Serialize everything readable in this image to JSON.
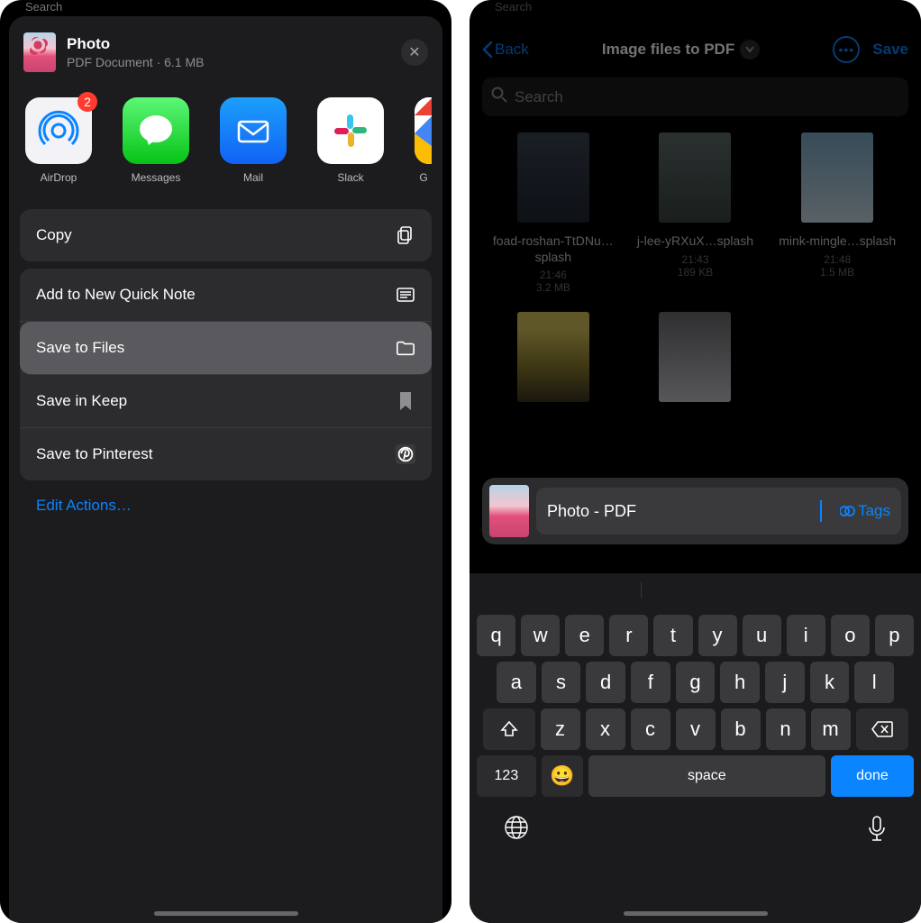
{
  "left": {
    "back_hint": "Search",
    "header": {
      "title": "Photo",
      "subtitle": "PDF Document · 6.1 MB"
    },
    "apps": [
      {
        "label": "AirDrop",
        "badge": "2"
      },
      {
        "label": "Messages"
      },
      {
        "label": "Mail"
      },
      {
        "label": "Slack"
      },
      {
        "label": "G"
      }
    ],
    "actions_a": [
      {
        "label": "Copy"
      }
    ],
    "actions_b": [
      {
        "label": "Add to New Quick Note"
      },
      {
        "label": "Save to Files",
        "highlight": true
      },
      {
        "label": "Save in Keep"
      },
      {
        "label": "Save to Pinterest"
      }
    ],
    "edit": "Edit Actions…"
  },
  "right": {
    "back_hint": "Search",
    "nav": {
      "back": "Back",
      "title": "Image files to PDF",
      "save": "Save"
    },
    "search_placeholder": "Search",
    "files": [
      {
        "name": "foad-roshan-TtDNu…splash",
        "date": "21:46",
        "size": "3.2 MB"
      },
      {
        "name": "j-lee-yRXuX…splash",
        "date": "21:43",
        "size": "189 KB"
      },
      {
        "name": "mink-mingle…splash",
        "date": "21:48",
        "size": "1.5 MB"
      },
      {
        "name": "",
        "date": "",
        "size": ""
      },
      {
        "name": "",
        "date": "",
        "size": ""
      }
    ],
    "rename": {
      "value": "Photo - PDF",
      "tags_label": "Tags"
    },
    "keyboard": {
      "row1": [
        "q",
        "w",
        "e",
        "r",
        "t",
        "y",
        "u",
        "i",
        "o",
        "p"
      ],
      "row2": [
        "a",
        "s",
        "d",
        "f",
        "g",
        "h",
        "j",
        "k",
        "l"
      ],
      "row3": [
        "z",
        "x",
        "c",
        "v",
        "b",
        "n",
        "m"
      ],
      "num": "123",
      "space": "space",
      "done": "done"
    }
  }
}
